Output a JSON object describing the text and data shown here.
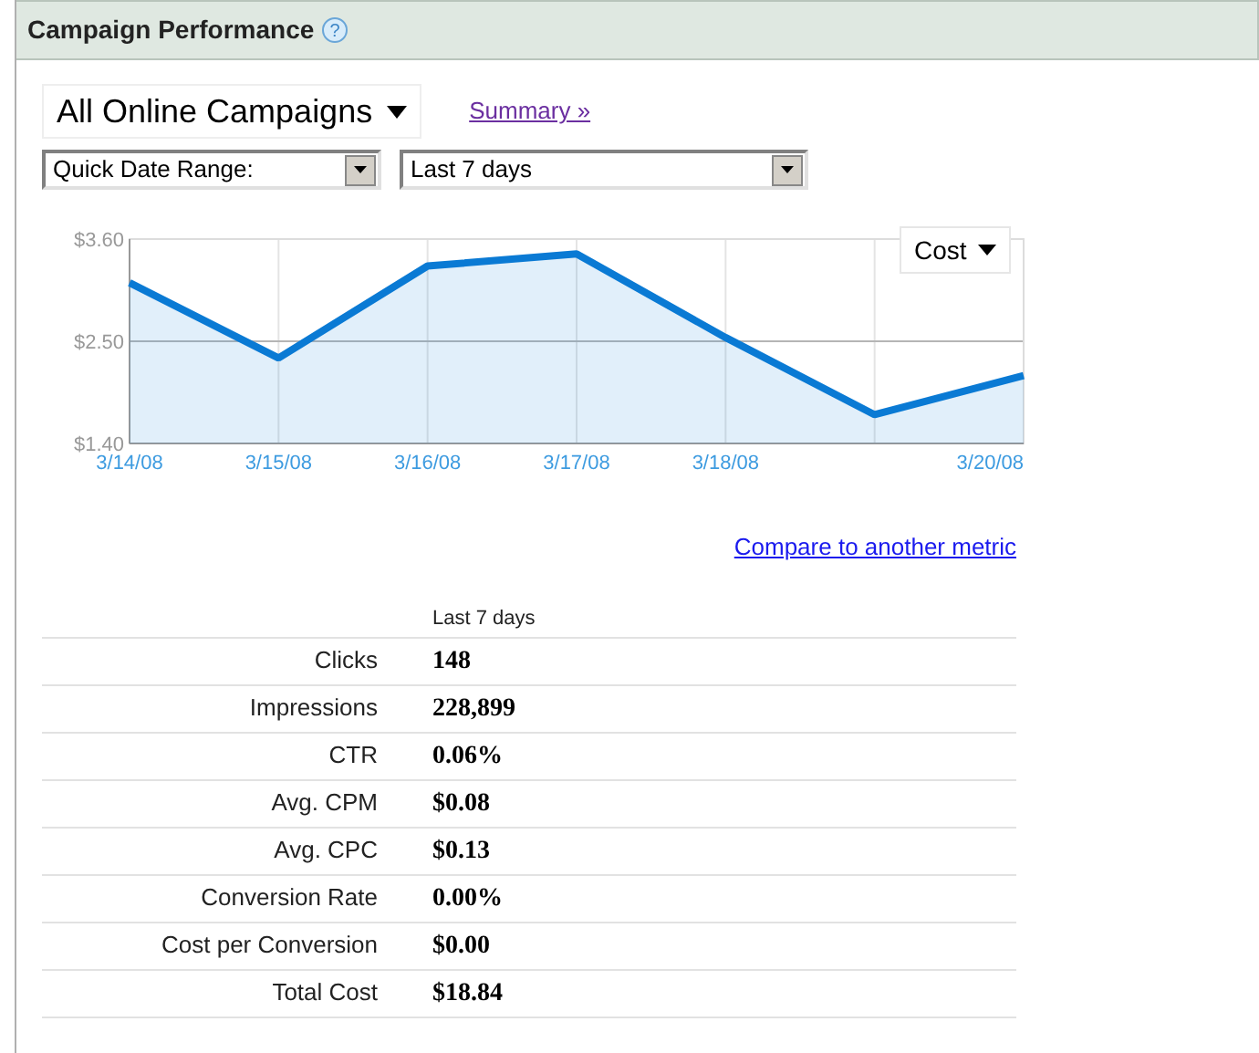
{
  "panel": {
    "title": "Campaign Performance",
    "help_icon": "?"
  },
  "campaign_menu": {
    "label": "All Online Campaigns"
  },
  "summary_link": "Summary »",
  "date_range_select": {
    "value": "Quick Date Range:"
  },
  "period_select": {
    "value": "Last 7 days"
  },
  "chart": {
    "chart_data": {
      "type": "area",
      "categories": [
        "3/14/08",
        "3/15/08",
        "3/16/08",
        "3/17/08",
        "3/18/08",
        null,
        "3/20/08"
      ],
      "series": [
        {
          "name": "Cost",
          "color": "#0a7ad4",
          "values": [
            3.13,
            2.32,
            3.31,
            3.44,
            2.54,
            1.71,
            2.13
          ]
        }
      ],
      "ylim": [
        1.4,
        3.6
      ],
      "yticks": [
        {
          "value": 1.4,
          "label": "$1.40"
        },
        {
          "value": 2.5,
          "label": "$2.50"
        },
        {
          "value": 3.6,
          "label": "$3.60"
        }
      ],
      "stacked": false,
      "grid": true,
      "ref_lines": [
        {
          "axis": "y",
          "value": 2.5
        }
      ]
    }
  },
  "compare_link": "Compare to another metric",
  "stats": {
    "column_header": "Last 7 days",
    "rows": [
      {
        "label": "Clicks",
        "value": "148"
      },
      {
        "label": "Impressions",
        "value": "228,899"
      },
      {
        "label": "CTR",
        "value": "0.06%"
      },
      {
        "label": "Avg. CPM",
        "value": "$0.08"
      },
      {
        "label": "Avg. CPC",
        "value": "$0.13"
      },
      {
        "label": "Conversion Rate",
        "value": "0.00%"
      },
      {
        "label": "Cost per Conversion",
        "value": "$0.00"
      },
      {
        "label": "Total Cost",
        "value": "$18.84"
      }
    ]
  }
}
